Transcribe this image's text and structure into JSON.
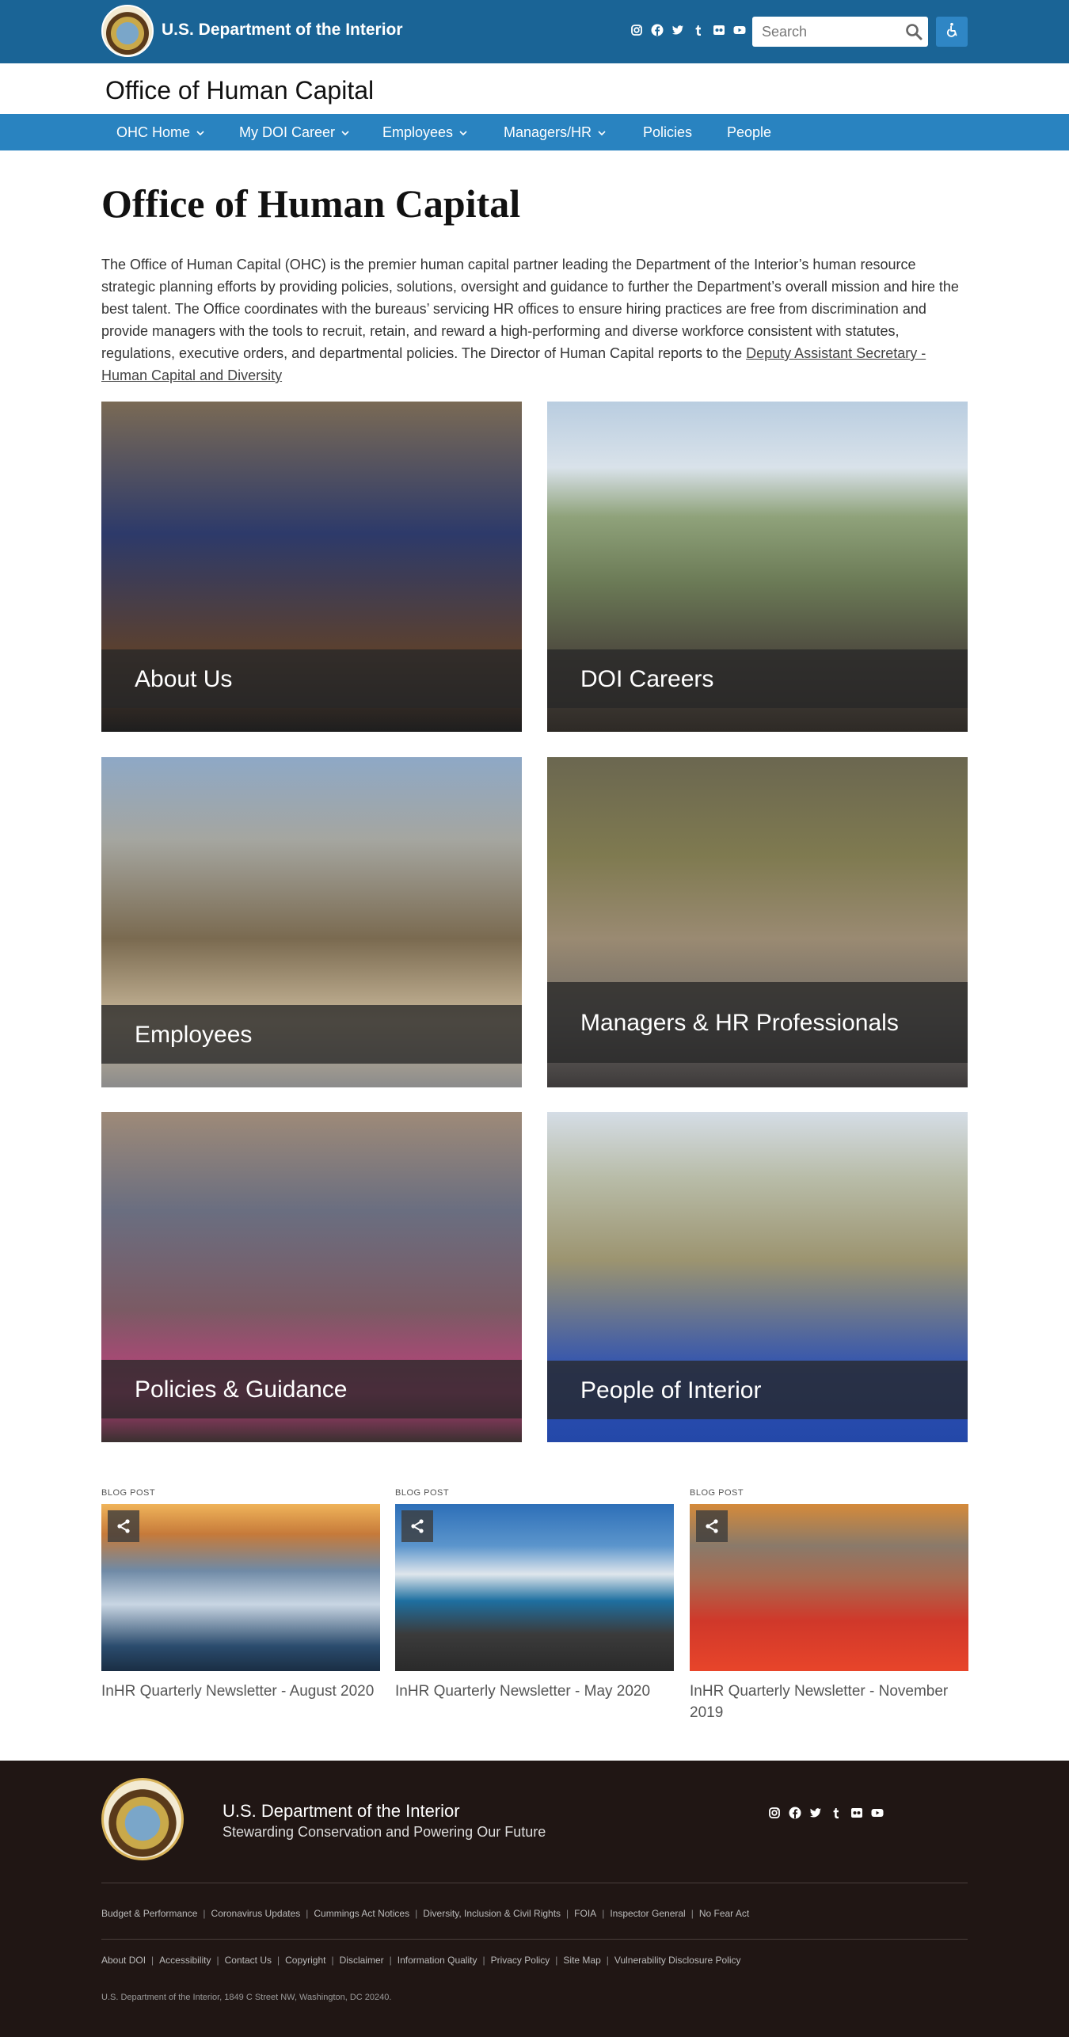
{
  "header": {
    "brand": "U.S. Department of the Interior",
    "search_placeholder": "Search",
    "office_name": "Office of Human Capital"
  },
  "social_icons": [
    "instagram-icon",
    "facebook-icon",
    "twitter-icon",
    "tumblr-icon",
    "flickr-icon",
    "youtube-icon"
  ],
  "nav": {
    "items": [
      {
        "label": "OHC Home",
        "dropdown": true
      },
      {
        "label": "My DOI Career",
        "dropdown": true
      },
      {
        "label": "Employees",
        "dropdown": true
      },
      {
        "label": "Managers/HR",
        "dropdown": true
      },
      {
        "label": "Policies",
        "dropdown": false
      },
      {
        "label": "People",
        "dropdown": false
      }
    ]
  },
  "main": {
    "title": "Office of Human Capital",
    "intro": "The Office of Human Capital (OHC) is the premier human capital partner leading the Department of the Interior’s human resource strategic planning efforts by providing policies, solutions, oversight and guidance to further the Department’s overall mission and hire the best talent. The Office coordinates with the bureaus’ servicing HR offices to ensure hiring practices are free from discrimination and provide managers with the tools to recruit, retain, and reward a high-performing and diverse workforce consistent with statutes, regulations, executive orders, and departmental policies. The Director of Human Capital reports to the",
    "intro_link": "Deputy Assistant Secretary - Human Capital and Diversity"
  },
  "tiles": [
    {
      "label": "About Us"
    },
    {
      "label": "DOI Careers"
    },
    {
      "label": "Employees"
    },
    {
      "label": "Managers & HR Professionals"
    },
    {
      "label": "Policies & Guidance"
    },
    {
      "label": "People of Interior"
    }
  ],
  "blog": {
    "posts": [
      {
        "tag": "BLOG POST",
        "title": "InHR Quarterly Newsletter - August 2020"
      },
      {
        "tag": "BLOG POST",
        "title": "InHR Quarterly Newsletter - May 2020"
      },
      {
        "tag": "BLOG POST",
        "title": "InHR Quarterly Newsletter - November 2019"
      }
    ]
  },
  "footer": {
    "title": "U.S. Department of the Interior",
    "subtitle": "Stewarding Conservation and Powering Our Future",
    "links_row1": [
      "Budget & Performance",
      "Coronavirus Updates",
      "Cummings Act Notices",
      "Diversity, Inclusion & Civil Rights",
      "FOIA",
      "Inspector General",
      "No Fear Act"
    ],
    "links_row2": [
      "About DOI",
      "Accessibility",
      "Contact Us",
      "Copyright",
      "Disclaimer",
      "Information Quality",
      "Privacy Policy",
      "Site Map",
      "Vulnerability Disclosure Policy"
    ],
    "address": "U.S. Department of the Interior, 1849 C Street NW, Washington, DC 20240."
  }
}
